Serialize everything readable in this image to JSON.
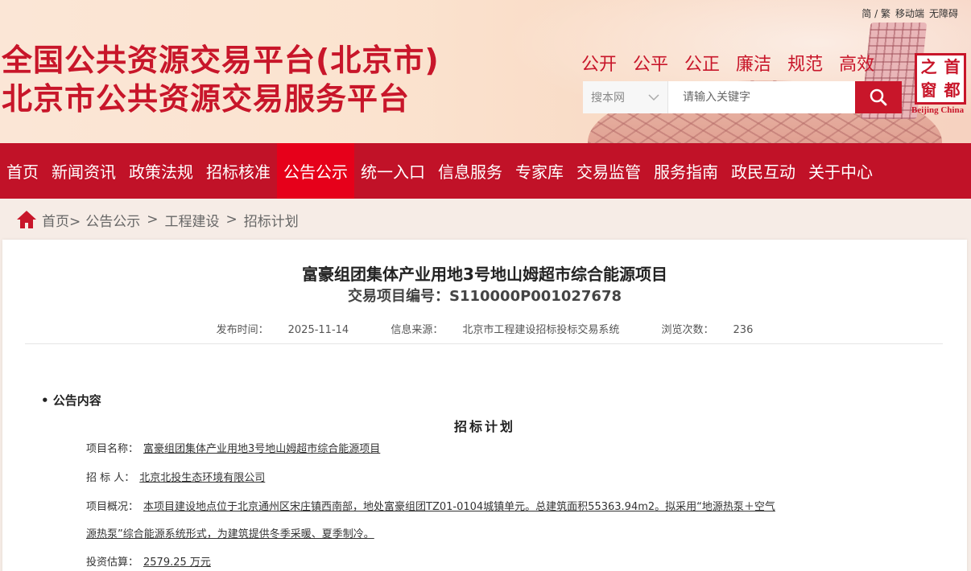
{
  "top_links": [
    "简 / 繁",
    "移动端",
    "无障碍"
  ],
  "site": {
    "title_line1": "全国公共资源交易平台(北京市)",
    "title_line2": "北京市公共资源交易服务平台"
  },
  "slogans": [
    "公开",
    "公平",
    "公正",
    "廉洁",
    "规范",
    "高效"
  ],
  "search": {
    "scope": "搜本网",
    "placeholder": "请输入关键字"
  },
  "logo": {
    "chars": [
      "之",
      "首",
      "窗",
      "都"
    ],
    "subtitle": "Beijing China"
  },
  "nav": [
    {
      "label": "首页",
      "active": false
    },
    {
      "label": "新闻资讯",
      "active": false
    },
    {
      "label": "政策法规",
      "active": false
    },
    {
      "label": "招标核准",
      "active": false
    },
    {
      "label": "公告公示",
      "active": true
    },
    {
      "label": "统一入口",
      "active": false
    },
    {
      "label": "信息服务",
      "active": false
    },
    {
      "label": "专家库",
      "active": false
    },
    {
      "label": "交易监管",
      "active": false
    },
    {
      "label": "服务指南",
      "active": false
    },
    {
      "label": "政民互动",
      "active": false
    },
    {
      "label": "关于中心",
      "active": false
    }
  ],
  "breadcrumb": {
    "home": "首页>",
    "items": [
      "公告公示",
      "工程建设",
      "招标计划"
    ]
  },
  "article": {
    "title": "富豪组团集体产业用地3号地山姆超市综合能源项目",
    "code": "交易项目编号：S110000P001027678",
    "publish_label": "发布时间：",
    "publish_date": "2025-11-14",
    "source_label": "信息来源：",
    "source": "北京市工程建设招标投标交易系统",
    "views_label": "浏览次数：",
    "views": "236"
  },
  "section_head": "• 公告内容",
  "plan": {
    "heading": "招标计划",
    "project_name_label": "项目名称：",
    "project_name": "富豪组团集体产业用地3号地山姆超市综合能源项目",
    "tenderer_label": "招 标 人：",
    "tenderer": "北京北投生态环境有限公司",
    "overview_label": "项目概况：",
    "overview_line1": "本项目建设地点位于北京通州区宋庄镇西南部，地处富豪组团TZ01-0104城镇单元。总建筑面积55363.94m2。拟采用“地源热泵＋空气",
    "overview_line2": "源热泵”综合能源系统形式，为建筑提供冬季采暖、夏季制冷。",
    "budget_label": "投资估算：",
    "budget": "2579.25 万元"
  }
}
